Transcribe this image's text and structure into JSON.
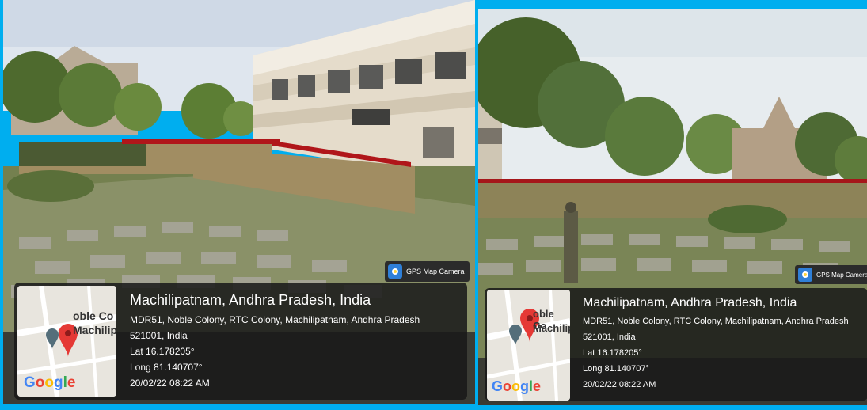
{
  "colors": {
    "border": "#00aeef",
    "panel": "#191919",
    "sky": "#dfe6ee",
    "grass": "#6b7a4a",
    "pin": "#e53935"
  },
  "photos": [
    {
      "gps_tag": {
        "icon": "map-pin-app-icon",
        "label": "GPS Map Camera"
      },
      "map": {
        "street_text_1": "oble Co",
        "street_text_2": "Machilip",
        "logo": "Google",
        "pin_icon": "location-pin-icon"
      },
      "place": "Machilipatnam, Andhra Pradesh, India",
      "address_line": "MDR51, Noble Colony, RTC Colony, Machilipatnam, Andhra Pradesh",
      "postal_line": "521001, India",
      "lat": "Lat 16.178205°",
      "long": "Long 81.140707°",
      "datetime": "20/02/22 08:22 AM"
    },
    {
      "gps_tag": {
        "icon": "map-pin-app-icon",
        "label": "GPS Map Camera"
      },
      "map": {
        "street_text_1": "oble Co",
        "street_text_2": "Machilip",
        "logo": "Google",
        "pin_icon": "location-pin-icon"
      },
      "place": "Machilipatnam, Andhra Pradesh, India",
      "address_line": "MDR51, Noble Colony, RTC Colony, Machilipatnam, Andhra Pradesh",
      "postal_line": "521001, India",
      "lat": "Lat 16.178205°",
      "long": "Long 81.140707°",
      "datetime": "20/02/22 08:22 AM"
    }
  ]
}
